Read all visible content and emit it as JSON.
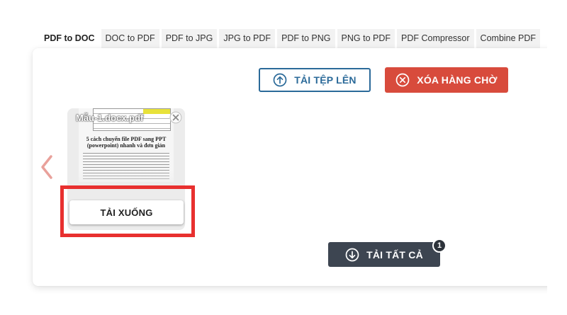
{
  "tabs": [
    {
      "label": "PDF to DOC",
      "active": true
    },
    {
      "label": "DOC to PDF"
    },
    {
      "label": "PDF to JPG"
    },
    {
      "label": "JPG to PDF"
    },
    {
      "label": "PDF to PNG"
    },
    {
      "label": "PNG to PDF"
    },
    {
      "label": "PDF Compressor"
    },
    {
      "label": "Combine PDF"
    }
  ],
  "toolbar": {
    "upload_label": "TẢI TỆP LÊN",
    "clear_queue_label": "XÓA HÀNG CHỜ"
  },
  "file_card": {
    "file_name": "Mẫu-1.docx.pdf",
    "preview_title": "5 cách chuyển file PDF sang PPT (powerpoint) nhanh và đơn giản",
    "download_label": "TẢI XUỐNG"
  },
  "download_all": {
    "label": "TẢI TẤT CẢ",
    "count": "1"
  },
  "colors": {
    "accent_blue": "#2b6a99",
    "danger_red": "#d84b3c",
    "dark_button": "#3d4551",
    "highlight_red": "#e8302f"
  },
  "icons": {
    "upload": "arrow-up-circle-icon",
    "clear": "x-circle-icon",
    "download_all": "arrow-down-circle-icon",
    "prev": "chevron-left-icon",
    "remove_file": "close-icon"
  }
}
